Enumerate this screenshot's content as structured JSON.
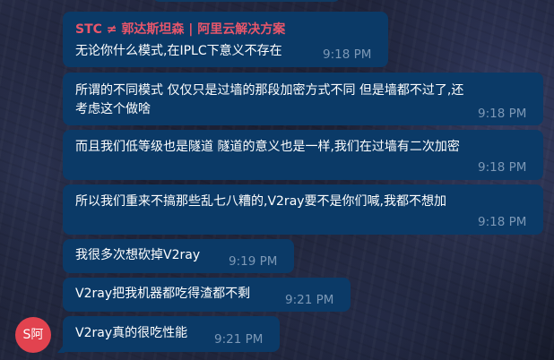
{
  "messages": [
    {
      "sender": "STC ≠ 郭达斯坦森 | 阿里云解决方案",
      "lines": [
        "无论你什么模式,在IPLC下意义不存在"
      ],
      "time": "9:18 PM"
    },
    {
      "lines": [
        "所谓的不同模式 仅仅只是过墙的那段加密方式不同 但是墙都不过了,还",
        "考虑这个做啥"
      ],
      "time": "9:18 PM"
    },
    {
      "lines": [
        "而且我们低等级也是隧道  隧道的意义也是一样,我们在过墙有二次加密"
      ],
      "time": "9:18 PM"
    },
    {
      "lines": [
        "所以我们重来不搞那些乱七八糟的,V2ray要不是你们喊,我都不想加"
      ],
      "time": "9:18 PM"
    },
    {
      "lines": [
        "我很多次想砍掉V2ray"
      ],
      "time": "9:19 PM"
    },
    {
      "lines": [
        "V2ray把我机器都吃得渣都不剩"
      ],
      "time": "9:21 PM"
    },
    {
      "lines": [
        "V2ray真的很吃性能"
      ],
      "time": "9:21 PM"
    }
  ],
  "avatar": {
    "initials": "S阿",
    "color": "#e2434f"
  },
  "colors": {
    "bubble": "#0b3a67",
    "sender_name": "#e9566a",
    "timestamp": "#7c98b6",
    "message_text": "#ffffff"
  }
}
